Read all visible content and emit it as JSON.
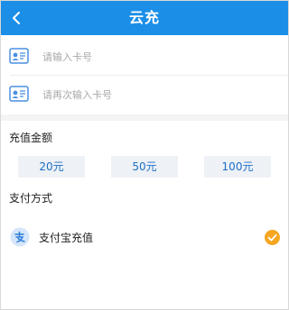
{
  "header": {
    "title": "云充",
    "background_color": "#1b8ee8",
    "back_icon": "chevron-left-icon"
  },
  "card_inputs": [
    {
      "placeholder": "请输入卡号",
      "value": "",
      "icon": "id-card-icon"
    },
    {
      "placeholder": "请再次输入卡号",
      "value": "",
      "icon": "id-card-icon"
    }
  ],
  "amount_section": {
    "title": "充值金额",
    "options": [
      "20元",
      "50元",
      "100元"
    ]
  },
  "payment_section": {
    "title": "支付方式",
    "methods": [
      {
        "label": "支付宝充值",
        "icon": "alipay-icon",
        "selected": true,
        "selected_color": "#f5a623"
      }
    ]
  }
}
